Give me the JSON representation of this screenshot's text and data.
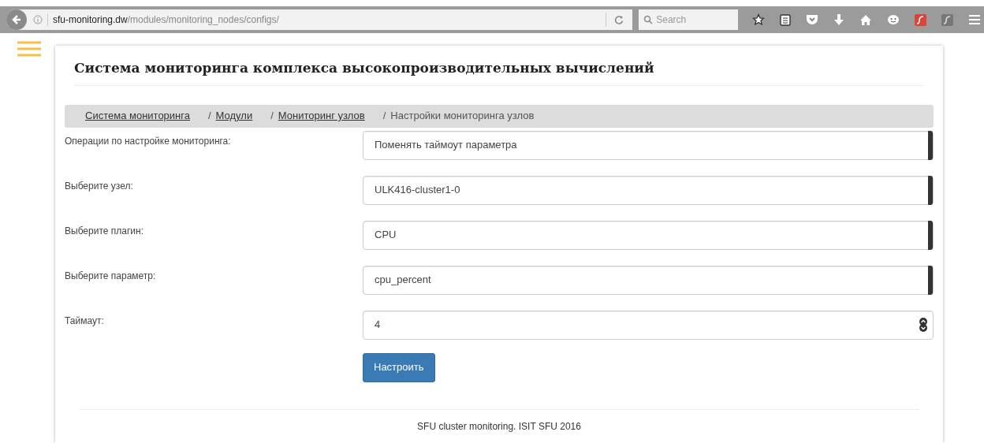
{
  "browser": {
    "url_host": "sfu-monitoring.dw",
    "url_path": "/modules/monitoring_nodes/configs/",
    "search": {
      "placeholder": "Search"
    }
  },
  "page": {
    "title": "Система мониторинга комплекса высокопроизводительных вычислений",
    "breadcrumbs": [
      {
        "label": "Система мониторинга",
        "kind": "link"
      },
      {
        "separator": "/",
        "label": "Модули",
        "kind": "link"
      },
      {
        "separator": "/",
        "label": "Мониторинг узлов",
        "kind": "link"
      },
      {
        "separator": "/",
        "label": "Настройки мониторинга узлов",
        "kind": "current"
      }
    ],
    "form": [
      {
        "label": "Операции по настройке мониторинга:",
        "value": "Поменять таймоут параметра",
        "kind": "select"
      },
      {
        "label": "Выберите узел:",
        "value": "ULK416-cluster1-0",
        "kind": "select"
      },
      {
        "label": "Выберите плагин:",
        "value": "CPU",
        "kind": "select"
      },
      {
        "label": "Выберите параметр:",
        "value": "cpu_percent",
        "kind": "select"
      },
      {
        "label": "Таймаут:",
        "value": "4",
        "kind": "number"
      }
    ],
    "submit": "Настроить",
    "footer": "SFU cluster monitoring. ISIT SFU 2016"
  }
}
